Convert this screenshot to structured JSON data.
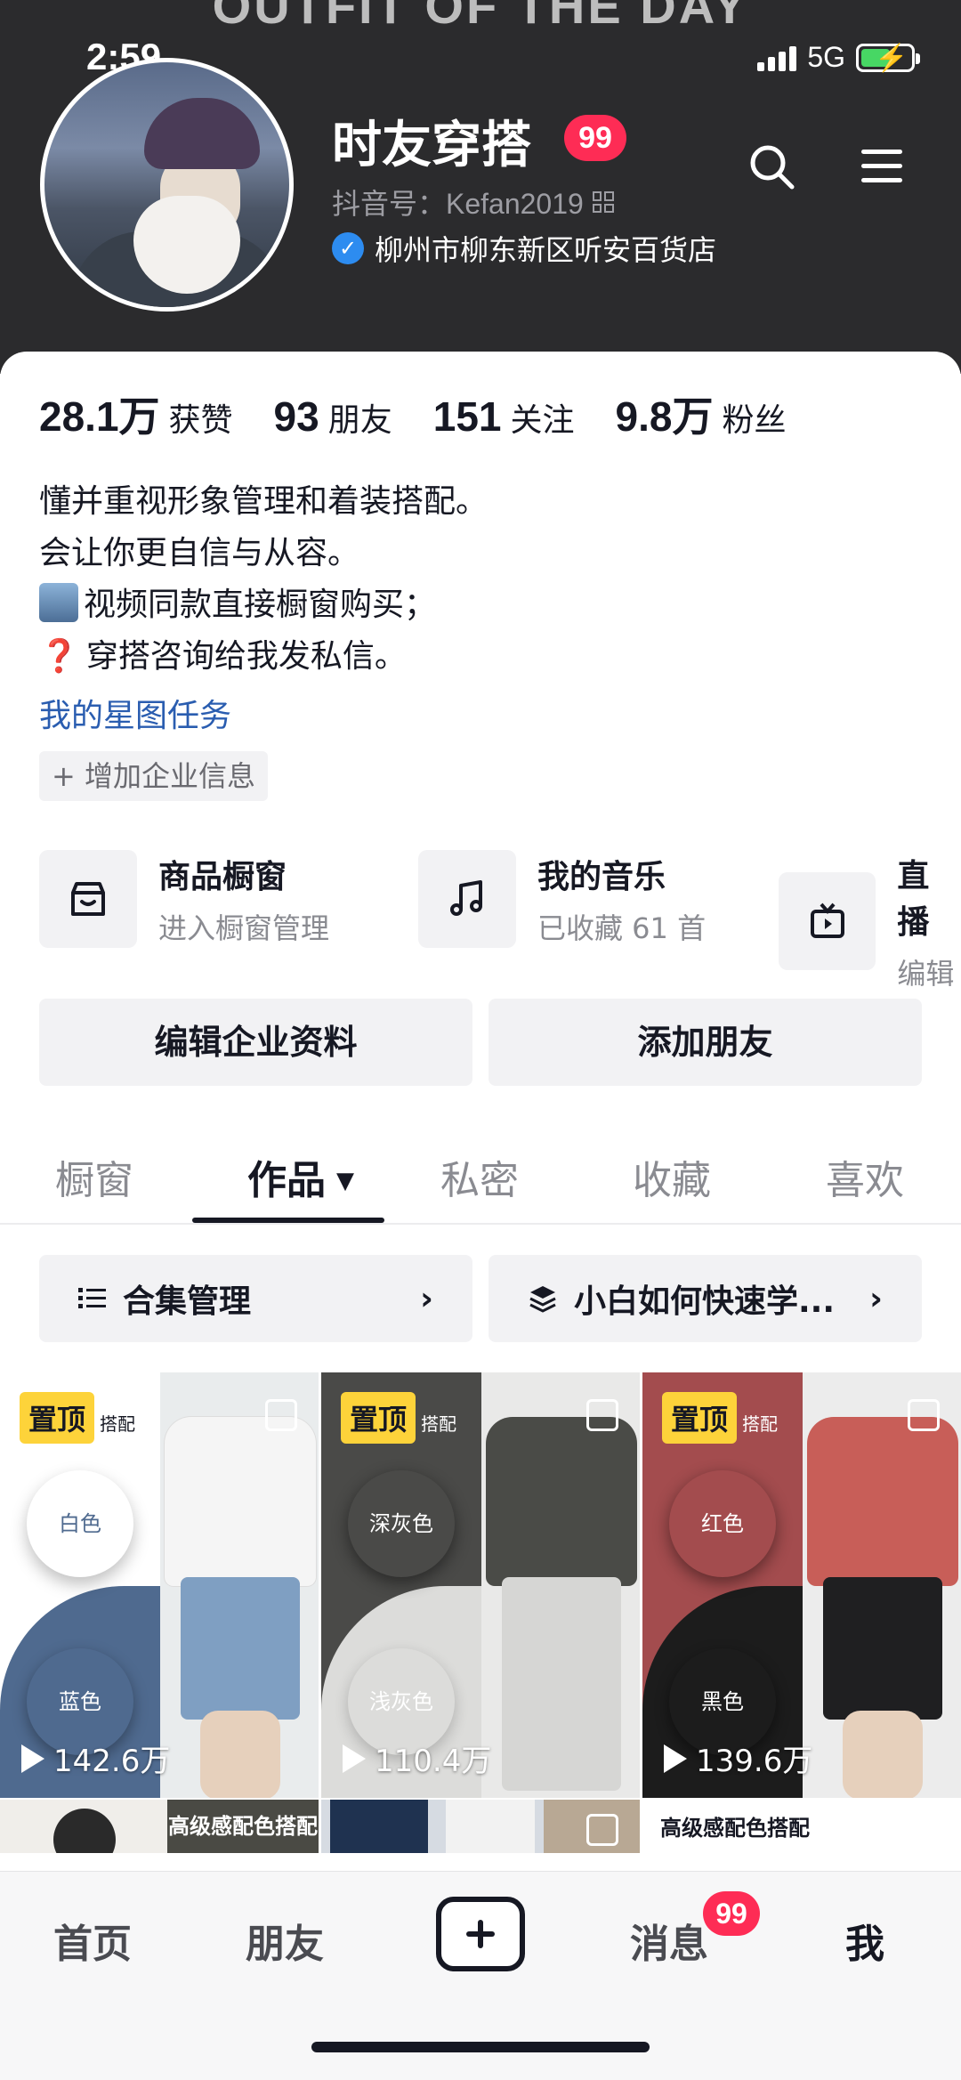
{
  "status_bar": {
    "time": "2:59",
    "network": "5G"
  },
  "header": {
    "banner_text": "OUTFIT OF THE DAY",
    "name": "时友穿搭",
    "badge_count": "99",
    "douyin_id": "抖音号：Kefan2019",
    "verified_text": "柳州市柳东新区听安百货店"
  },
  "stats": [
    {
      "num": "28.1万",
      "label": "获赞"
    },
    {
      "num": "93",
      "label": "朋友"
    },
    {
      "num": "151",
      "label": "关注"
    },
    {
      "num": "9.8万",
      "label": "粉丝"
    }
  ],
  "bio": {
    "line1": "懂并重视形象管理和着装搭配。",
    "line2": "会让你更自信与从容。",
    "line3": "视频同款直接橱窗购买；",
    "line4_mark": "❓",
    "line4": "穿搭咨询给我发私信。",
    "link": "我的星图任务",
    "add_biz": "+ 增加企业信息"
  },
  "features": [
    {
      "title": "商品橱窗",
      "sub": "进入橱窗管理",
      "icon": "store-icon"
    },
    {
      "title": "我的音乐",
      "sub": "已收藏 61 首",
      "icon": "music-icon"
    },
    {
      "title": "直播",
      "sub": "编辑",
      "icon": "tv-icon"
    }
  ],
  "buttons": {
    "edit_profile": "编辑企业资料",
    "add_friend": "添加朋友"
  },
  "tabs": [
    "橱窗",
    "作品",
    "私密",
    "收藏",
    "喜欢"
  ],
  "collections": {
    "left": "合集管理",
    "right": "小白如何快速学..."
  },
  "videos": [
    {
      "pinned": "置顶",
      "views": "142.6万",
      "title_text": "搭配",
      "top_circle": "白色",
      "bottom_circle": "蓝色",
      "colors": {
        "bg_top": "#ffffff",
        "bg_bottom": "#4f6a8f",
        "shirt": "#f5f5f5",
        "shorts": "#7f9fc2",
        "backdrop": "#e9eced"
      }
    },
    {
      "pinned": "置顶",
      "views": "110.4万",
      "title_text": "搭配",
      "top_circle": "深灰色",
      "bottom_circle": "浅灰色",
      "colors": {
        "bg_top": "#4a4a48",
        "bg_bottom": "#dcdcda",
        "shirt": "#4a4b47",
        "shorts": "#d6d6d4",
        "backdrop": "#e9e9e8"
      }
    },
    {
      "pinned": "置顶",
      "views": "139.6万",
      "title_text": "搭配",
      "top_circle": "红色",
      "bottom_circle": "黑色",
      "colors": {
        "bg_top": "#a34c4e",
        "bg_bottom": "#1c1c1c",
        "shirt": "#c85e58",
        "shorts": "#1f1f21",
        "backdrop": "#ececec"
      }
    }
  ],
  "row2_texts": {
    "a": "高级感配色搭配",
    "b": "高级感配色搭配"
  },
  "bottom_nav": {
    "home": "首页",
    "friends": "朋友",
    "messages": "消息",
    "messages_badge": "99",
    "me": "我"
  }
}
